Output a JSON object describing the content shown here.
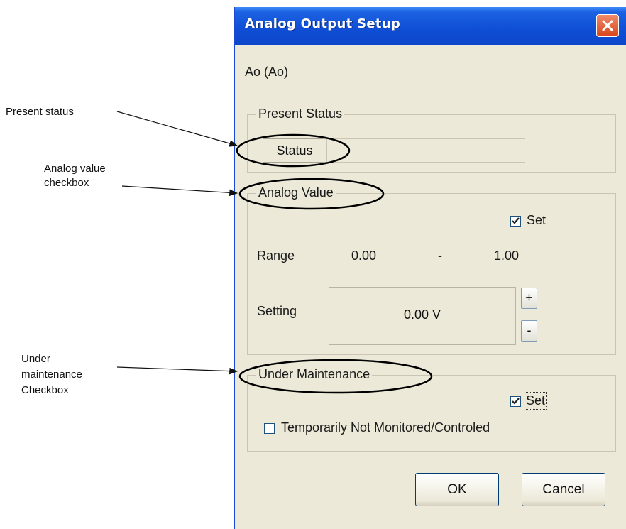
{
  "annotations": {
    "present_status": "Present status",
    "analog_value_line1": "Analog value",
    "analog_value_line2": "checkbox",
    "maintenance_line1": "Under",
    "maintenance_line2": "maintenance",
    "maintenance_line3": "Checkbox"
  },
  "dialog": {
    "title": "Analog Output Setup",
    "point_name": "Ao  (Ao)",
    "present_status": {
      "legend": "Present Status",
      "status_label": "Status",
      "status_value": ""
    },
    "analog_value": {
      "legend": "Analog Value",
      "set_label": "Set",
      "set_checked": true,
      "range_label": "Range",
      "range_min": "0.00",
      "range_sep": "-",
      "range_max": "1.00",
      "setting_label": "Setting",
      "setting_value": "0.00 V",
      "increment_label": "+",
      "decrement_label": "-"
    },
    "maintenance": {
      "legend": "Under Maintenance",
      "set_label": "Set",
      "set_checked": true,
      "not_monitored_label": "Temporarily Not Monitored/Controled",
      "not_monitored_checked": false
    },
    "ok_label": "OK",
    "cancel_label": "Cancel"
  }
}
